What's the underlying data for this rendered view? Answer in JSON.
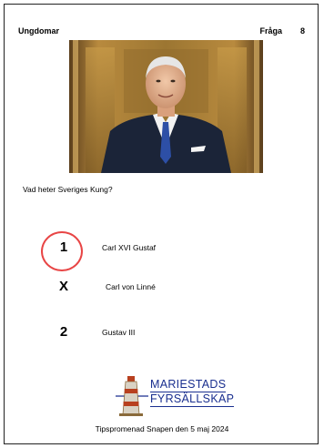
{
  "header": {
    "category": "Ungdomar",
    "question_label": "Fråga",
    "question_number": "8"
  },
  "question": {
    "text": "Vad heter Sveriges Kung?"
  },
  "options": [
    {
      "mark": "1",
      "text": "Carl XVI Gustaf"
    },
    {
      "mark": "X",
      "text": "Carl von Linné"
    },
    {
      "mark": "2",
      "text": "Gustav III"
    }
  ],
  "logo": {
    "line1": "MARIESTADS",
    "line2": "FYRSÄLLSKAP"
  },
  "footer": {
    "text": "Tipspromenad Snapen den 5 maj 2024"
  },
  "colors": {
    "answer_circle": "#e84545",
    "logo_blue": "#1a2f8f"
  }
}
